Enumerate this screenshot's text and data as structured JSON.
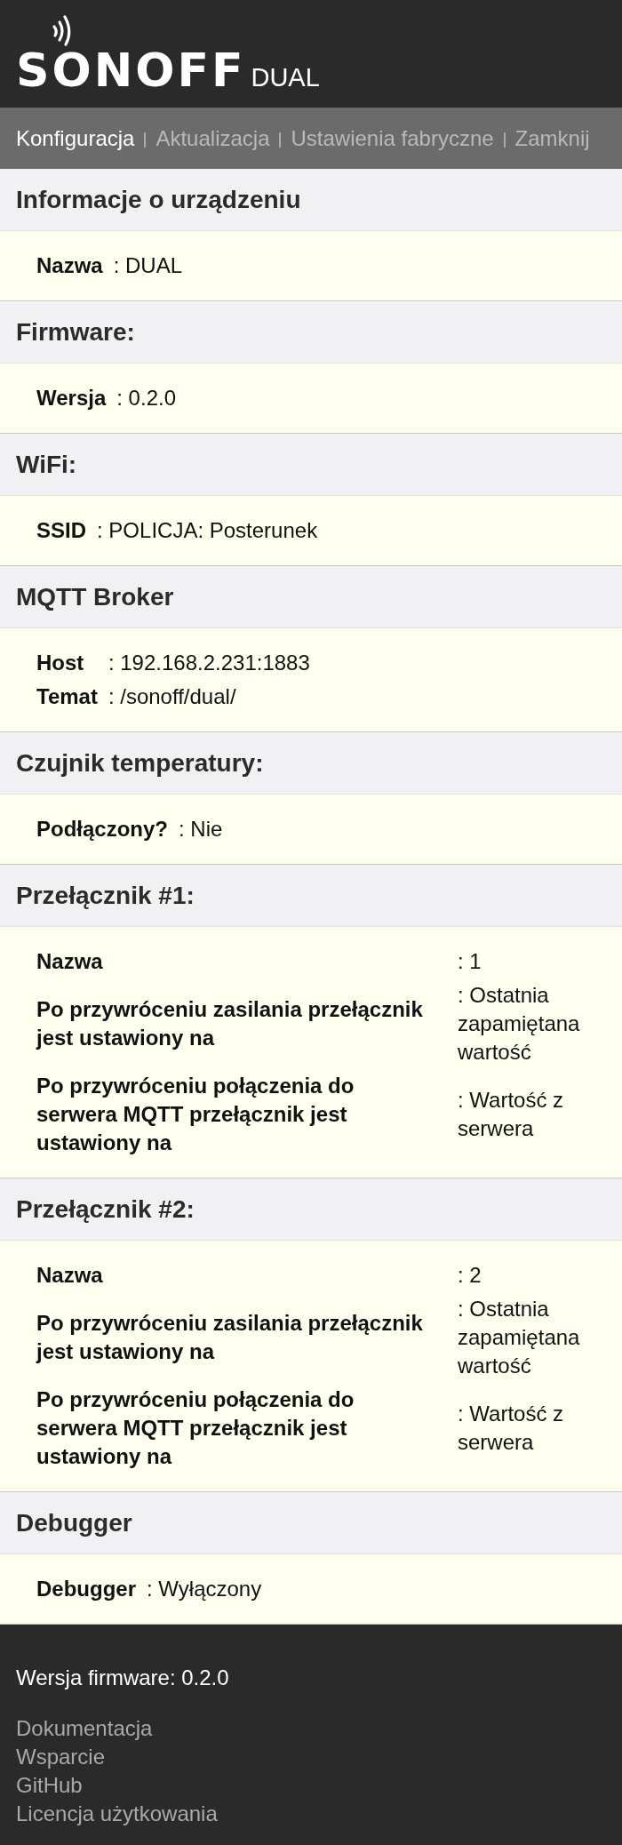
{
  "header": {
    "logo": "SONOFF",
    "model": "DUAL"
  },
  "nav": [
    {
      "label": "Konfiguracja",
      "selected": true
    },
    {
      "label": "Aktualizacja",
      "selected": false
    },
    {
      "label": "Ustawienia fabryczne",
      "selected": false
    },
    {
      "label": "Zamknij",
      "selected": false
    }
  ],
  "sections": [
    {
      "title": "Informacje o urządzeniu",
      "kind": "compact",
      "rows": [
        {
          "label": "Nazwa",
          "value": ": DUAL"
        }
      ]
    },
    {
      "title": "Firmware:",
      "kind": "compact",
      "rows": [
        {
          "label": "Wersja",
          "value": ": 0.2.0"
        }
      ]
    },
    {
      "title": "WiFi:",
      "kind": "compact",
      "rows": [
        {
          "label": "SSID",
          "value": ": POLICJA: Posterunek"
        }
      ]
    },
    {
      "title": "MQTT Broker",
      "kind": "compact",
      "rows": [
        {
          "label": "Host",
          "value": ": 192.168.2.231:1883"
        },
        {
          "label": "Temat",
          "value": ": /sonoff/dual/"
        }
      ]
    },
    {
      "title": "Czujnik temperatury:",
      "kind": "compact",
      "rows": [
        {
          "label": "Podłączony?",
          "value": ": Nie"
        }
      ]
    },
    {
      "title": "Przełącznik #1:",
      "kind": "wide",
      "rows": [
        {
          "label": "Nazwa",
          "value": ": 1"
        },
        {
          "label": "Po przywróceniu zasilania przełącznik jest ustawiony na",
          "value": ": Ostatnia zapamiętana wartość"
        },
        {
          "label": "Po przywróceniu połączenia do serwera MQTT przełącznik jest ustawiony na",
          "value": ": Wartość z serwera"
        }
      ]
    },
    {
      "title": "Przełącznik #2:",
      "kind": "wide",
      "rows": [
        {
          "label": "Nazwa",
          "value": ": 2"
        },
        {
          "label": "Po przywróceniu zasilania przełącznik jest ustawiony na",
          "value": ": Ostatnia zapamiętana wartość"
        },
        {
          "label": "Po przywróceniu połączenia do serwera MQTT przełącznik jest ustawiony na",
          "value": ": Wartość z serwera"
        }
      ]
    },
    {
      "title": "Debugger",
      "kind": "compact",
      "rows": [
        {
          "label": "Debugger",
          "value": ": Wyłączony"
        }
      ]
    }
  ],
  "footer": {
    "version": "Wersja firmware: 0.2.0",
    "links": [
      "Dokumentacja",
      "Wsparcie",
      "GitHub",
      "Licencja użytkowania"
    ]
  }
}
